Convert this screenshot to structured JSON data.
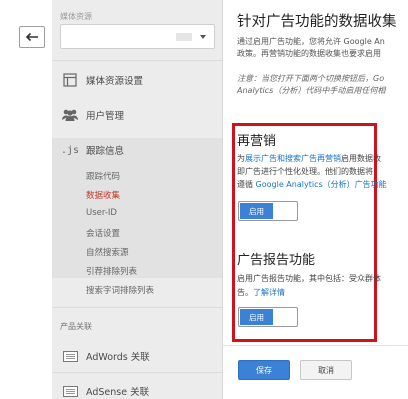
{
  "nav": {
    "back_icon": "back-arrow-icon"
  },
  "sidebar": {
    "property_label": "媒体资源",
    "property_value": "",
    "items": [
      {
        "icon": "property-settings-icon",
        "label": "媒体资源设置"
      },
      {
        "icon": "user-management-icon",
        "label": "用户管理"
      },
      {
        "icon": "js-tracking-icon",
        "label": "跟踪信息"
      }
    ],
    "tracking_icon_text": ".js",
    "subitems": [
      "跟踪代码",
      "数据收集",
      "User-ID",
      "会话设置",
      "自然搜索源",
      "引荐排除列表",
      "搜索字词排除列表"
    ],
    "active_subitem": "数据收集",
    "product_links_label": "产品关联",
    "product_links": [
      {
        "icon": "adwords-icon",
        "label": "AdWords 关联"
      },
      {
        "icon": "adsense-icon",
        "label": "AdSense 关联"
      }
    ]
  },
  "main": {
    "title": "针对广告功能的数据收集",
    "intro_line1": "通过启用广告功能，您将允许 Google An",
    "intro_line2": "政策。再营销功能的数据收集也要求启用",
    "note_line1": "注意：当您打开下面两个切换按钮后，Go",
    "note_line2": "Analytics（分析）代码中手动启用任何相",
    "remarketing": {
      "title": "再营销",
      "line1_prefix": "为",
      "line1_link": "展示广告和搜索广告再营销",
      "line1_suffix": "启用数据收",
      "line2": "即广告进行个性化处理。他们的数据将",
      "line3_prefix": "遵循 ",
      "line3_link": "Google Analytics（分析）广告功能",
      "toggle_label": "启用"
    },
    "reporting": {
      "title": "广告报告功能",
      "line1": "启用广告报告功能，其中包括：受众群体",
      "line2_prefix": "告。",
      "line2_link": "了解详情",
      "toggle_label": "启用"
    },
    "save_label": "保存",
    "cancel_label": "取消"
  },
  "colors": {
    "accent": "#3b82d6",
    "highlight": "#d0121b",
    "active_nav": "#c0392b"
  }
}
